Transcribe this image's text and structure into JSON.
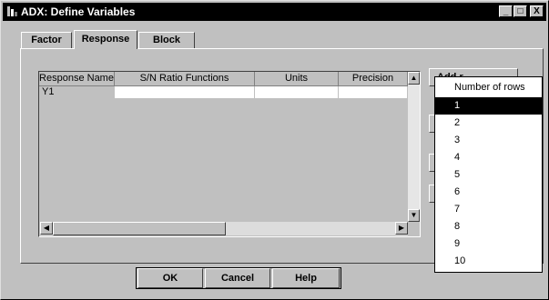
{
  "window": {
    "title": "ADX: Define Variables"
  },
  "title_buttons": {
    "minimize": "_",
    "maximize": "□",
    "close": "X"
  },
  "tabs": [
    {
      "label": "Factor"
    },
    {
      "label": "Response"
    },
    {
      "label": "Block"
    }
  ],
  "grid": {
    "columns": [
      "Response Name",
      "S/N Ratio Functions",
      "Units",
      "Precision"
    ],
    "rows": [
      {
        "name": "Y1",
        "sn": "",
        "units": "",
        "precision": ""
      }
    ]
  },
  "add_rows_button": {
    "label": "Add r"
  },
  "row_count_menu": {
    "title": "Number of rows",
    "items": [
      "1",
      "2",
      "3",
      "4",
      "5",
      "6",
      "7",
      "8",
      "9",
      "10"
    ],
    "selected": "1"
  },
  "footer": {
    "ok": "OK",
    "cancel": "Cancel",
    "help": "Help"
  }
}
